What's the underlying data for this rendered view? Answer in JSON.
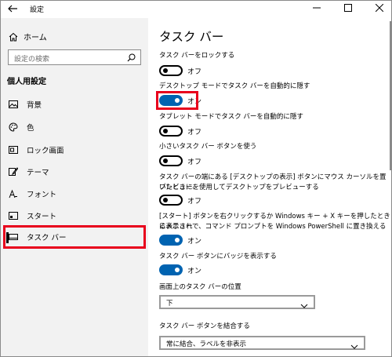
{
  "window": {
    "title": "設定"
  },
  "sidebar": {
    "home_label": "ホーム",
    "search_placeholder": "設定の検索",
    "section_label": "個人用設定",
    "items": [
      {
        "label": "背景",
        "icon": "image-icon"
      },
      {
        "label": "色",
        "icon": "palette-icon"
      },
      {
        "label": "ロック画面",
        "icon": "lock-screen-icon"
      },
      {
        "label": "テーマ",
        "icon": "theme-brush-icon"
      },
      {
        "label": "フォント",
        "icon": "font-icon"
      },
      {
        "label": "スタート",
        "icon": "start-tiles-icon"
      },
      {
        "label": "タスク バー",
        "icon": "taskbar-icon",
        "selected": true
      }
    ]
  },
  "main": {
    "title": "タスク バー",
    "settings": [
      {
        "label": "タスク バーをロックする",
        "state": "オフ",
        "on": false
      },
      {
        "label": "デスクトップ モードでタスク バーを自動的に隠す",
        "state": "オン",
        "on": true
      },
      {
        "label": "タブレット モードでタスク バーを自動的に隠す",
        "state": "オフ",
        "on": false
      },
      {
        "label": "小さいタスク バー ボタンを使う",
        "state": "オフ",
        "on": false
      },
      {
        "label_line1": "タスク バーの端にある [デスクトップの表示] ボタンにマウス カーソルを置いたときに、",
        "label_line2": "プレビューを使用してデスクトップをプレビューする",
        "state": "オフ",
        "on": false
      },
      {
        "label_line1": "[スタート] ボタンを右クリックするか Windows キー + X キーを押したときに表示され",
        "label_line2": "るメニューで、コマンド プロンプトを Windows PowerShell に置き換える",
        "state": "オン",
        "on": true
      },
      {
        "label": "タスク バー ボタンにバッジを表示する",
        "state": "オン",
        "on": true
      }
    ],
    "position": {
      "label": "画面上のタスク バーの位置",
      "value": "下"
    },
    "combine": {
      "label": "タスク バー ボタンを結合する",
      "value": "常に結合、ラベルを非表示"
    }
  },
  "colors": {
    "accent": "#0063b1",
    "highlight": "#e8001c",
    "sidebar_bg": "#f2f2f2"
  }
}
